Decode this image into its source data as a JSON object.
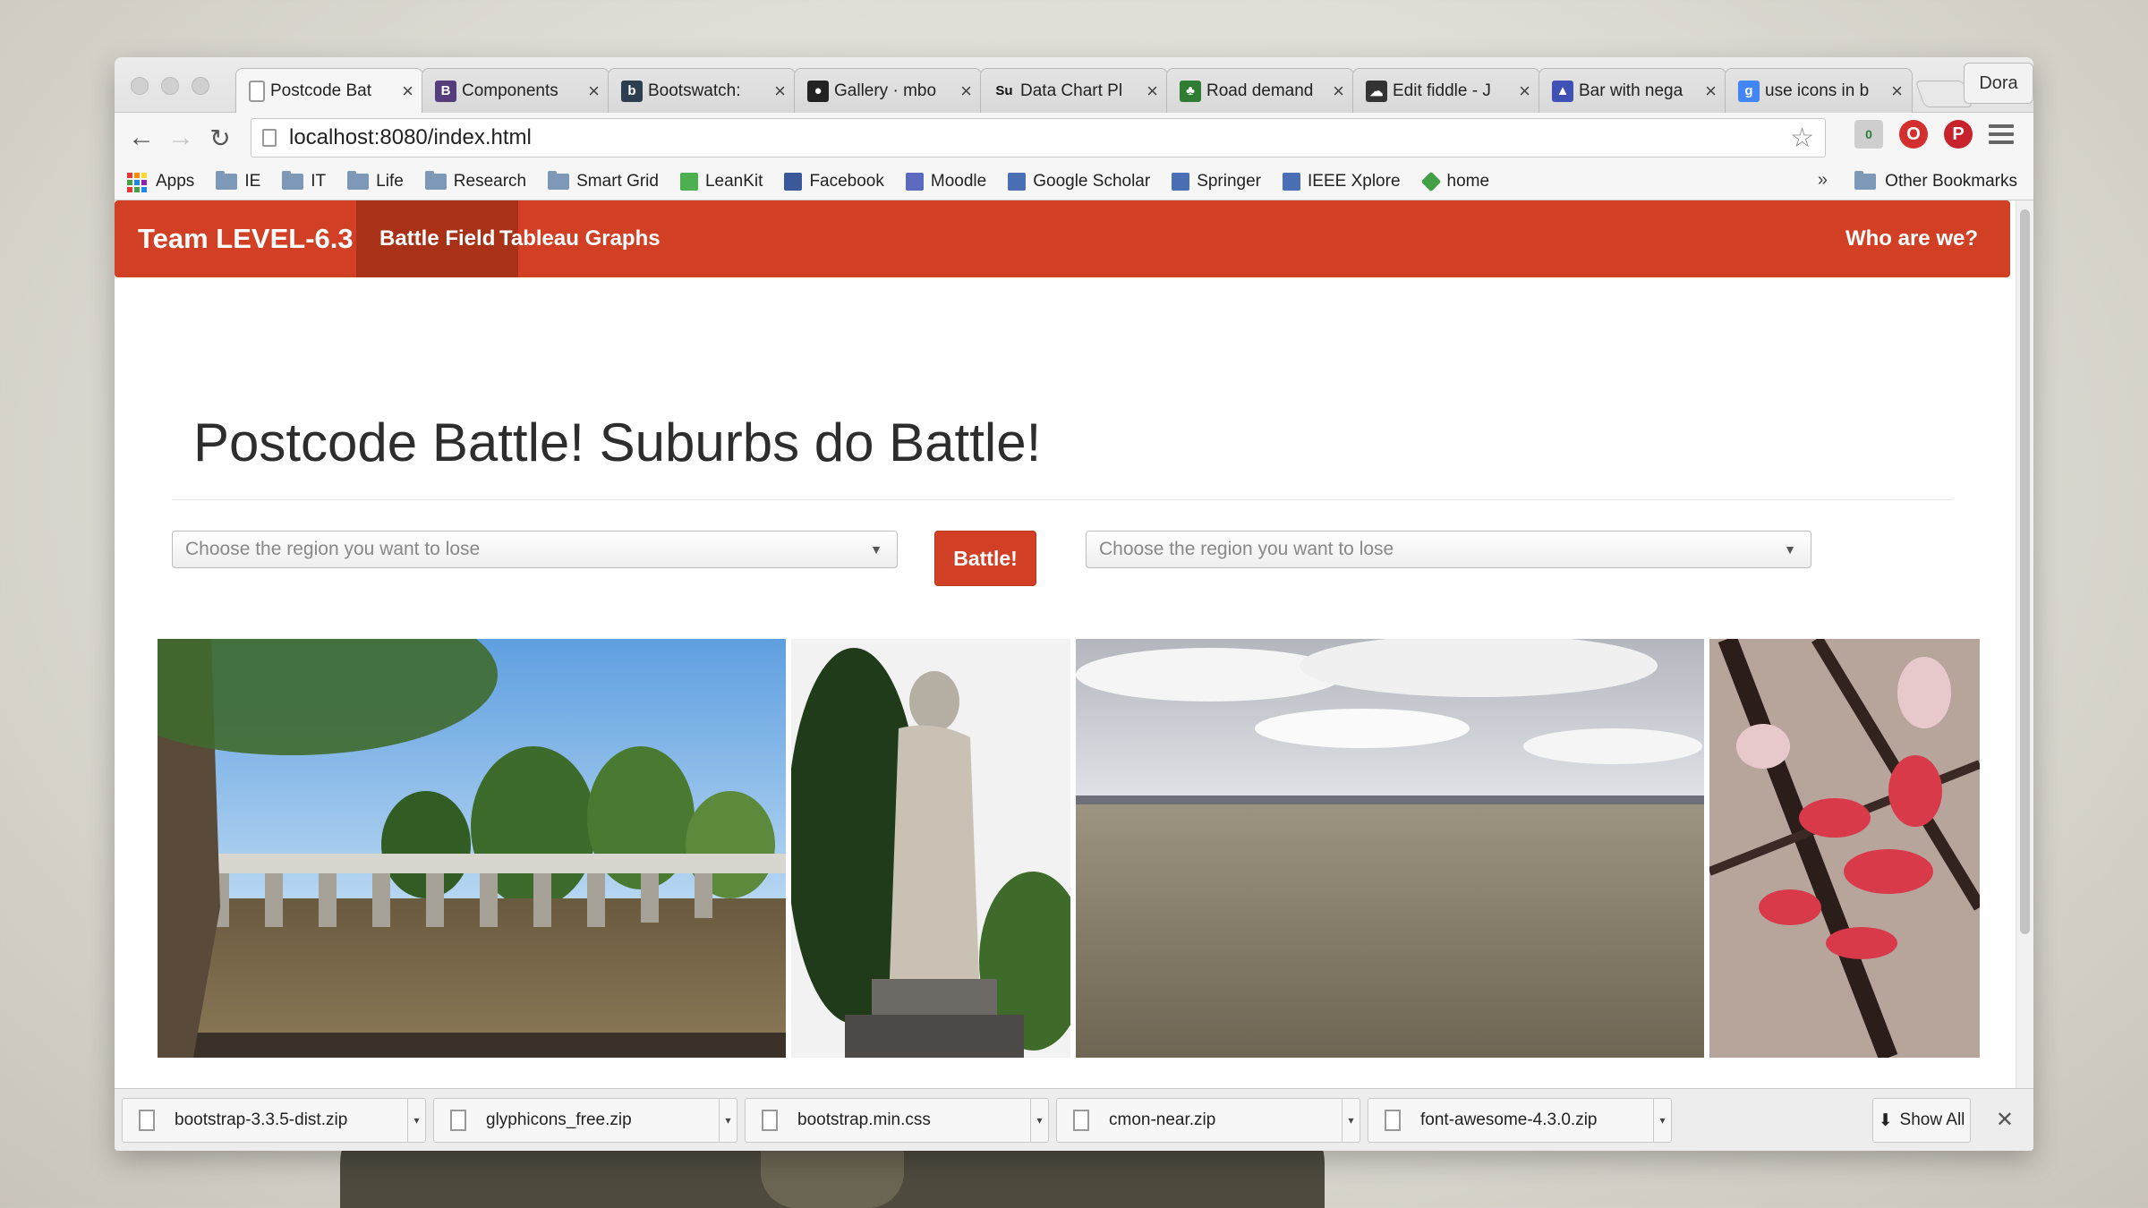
{
  "browser": {
    "tabs": [
      {
        "label": "Postcode Bat",
        "icon": "page-icon",
        "color": "#ffffff"
      },
      {
        "label": "Components",
        "icon": "bootstrap-icon",
        "color": "#563d7c",
        "glyph": "B"
      },
      {
        "label": "Bootswatch: ",
        "icon": "bootswatch-icon",
        "color": "#2c3e50",
        "glyph": "b"
      },
      {
        "label": "Gallery · mbo",
        "icon": "github-icon",
        "color": "#222222",
        "glyph": "●"
      },
      {
        "label": "Data Chart Pl",
        "icon": "su-icon",
        "color": "#ffffff",
        "glyph": "Su"
      },
      {
        "label": "Road demand",
        "icon": "tree-icon",
        "color": "#2e7d32",
        "glyph": "♣"
      },
      {
        "label": "Edit fiddle - J",
        "icon": "cloud-icon",
        "color": "#333333",
        "glyph": "☁"
      },
      {
        "label": "Bar with nega",
        "icon": "chart-icon",
        "color": "#3f51b5",
        "glyph": "▲"
      },
      {
        "label": "use icons in b",
        "icon": "google-icon",
        "color": "#4285f4",
        "glyph": "g"
      }
    ],
    "profile": "Dora",
    "url": "localhost:8080/index.html",
    "bookmarks": [
      {
        "label": "Apps",
        "icon": "apps-grid-icon"
      },
      {
        "label": "IE",
        "icon": "folder-icon"
      },
      {
        "label": "IT",
        "icon": "folder-icon"
      },
      {
        "label": "Life",
        "icon": "folder-icon"
      },
      {
        "label": "Research",
        "icon": "folder-icon"
      },
      {
        "label": "Smart Grid",
        "icon": "folder-icon"
      },
      {
        "label": "LeanKit",
        "icon": "leankit-icon"
      },
      {
        "label": "Facebook",
        "icon": "facebook-icon"
      },
      {
        "label": "Moodle",
        "icon": "moodle-icon"
      },
      {
        "label": "Google Scholar",
        "icon": "scholar-icon"
      },
      {
        "label": "Springer",
        "icon": "springer-icon"
      },
      {
        "label": "IEEE Xplore",
        "icon": "ieee-icon"
      },
      {
        "label": "home",
        "icon": "home-diamond-icon"
      }
    ],
    "chevron": "»",
    "other_bookmarks": "Other Bookmarks"
  },
  "site": {
    "brand": "Team LEVEL-6.3",
    "nav": [
      {
        "label": "Battle Field",
        "active": true
      },
      {
        "label": "Tableau Graphs",
        "active": false
      }
    ],
    "nav_right": "Who are we?",
    "heading": "Postcode Battle! Suburbs do Battle!",
    "left_select_placeholder": "Choose the region you want to lose",
    "right_select_placeholder": "Choose the region you want to lose",
    "battle_button": "Battle!",
    "accent_color": "#d13f24"
  },
  "downloads": {
    "items": [
      {
        "label": "bootstrap-3.3.5-dist.zip"
      },
      {
        "label": "glyphicons_free.zip"
      },
      {
        "label": "bootstrap.min.css"
      },
      {
        "label": "cmon-near.zip"
      },
      {
        "label": "font-awesome-4.3.0.zip"
      }
    ],
    "show_all": "Show All"
  }
}
